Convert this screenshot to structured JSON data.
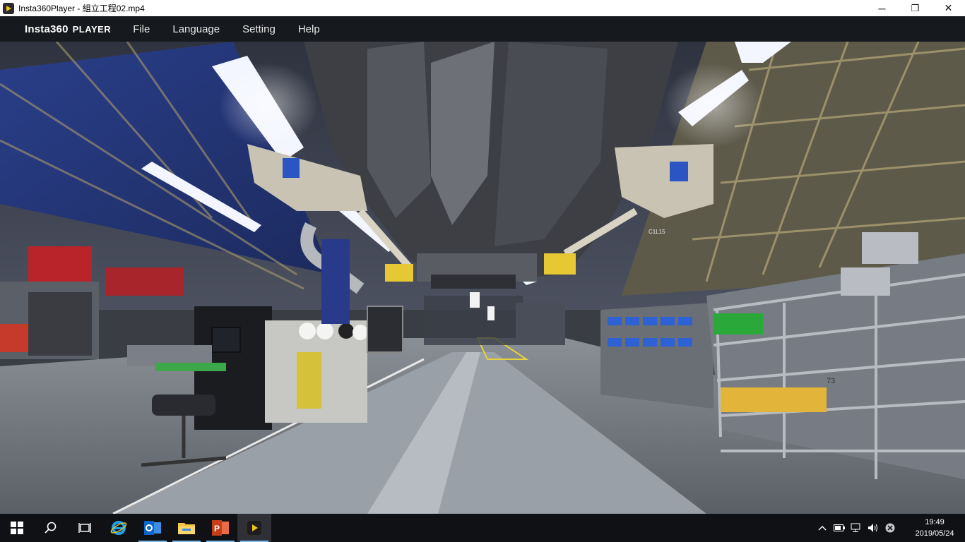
{
  "window": {
    "title": "Insta360Player - 組立工程02.mp4",
    "minimize_glyph": "─",
    "maximize_glyph": "❐",
    "close_glyph": "✕"
  },
  "menubar": {
    "brand": "Insta360",
    "brand_sub": "PLAYER",
    "items": [
      "File",
      "Language",
      "Setting",
      "Help"
    ]
  },
  "viewport": {
    "content": "360° video frame of car assembly line",
    "signs": [
      "C1L15",
      "73"
    ]
  },
  "taskbar": {
    "apps": [
      {
        "icon": "windows-start-icon",
        "running": false
      },
      {
        "icon": "search-icon",
        "running": false
      },
      {
        "icon": "task-view-icon",
        "running": false
      },
      {
        "icon": "internet-explorer-icon",
        "running": false
      },
      {
        "icon": "outlook-icon",
        "running": true
      },
      {
        "icon": "file-explorer-icon",
        "running": true
      },
      {
        "icon": "powerpoint-icon",
        "running": true
      },
      {
        "icon": "insta360-player-icon",
        "running": true,
        "active": true
      }
    ],
    "tray": {
      "chevron": "^",
      "time": "19:49",
      "date": "2019/05/24"
    }
  },
  "colors": {
    "menubar_bg": "#16191d",
    "taskbar_bg": "#101114",
    "accent": "#76b9ed"
  }
}
